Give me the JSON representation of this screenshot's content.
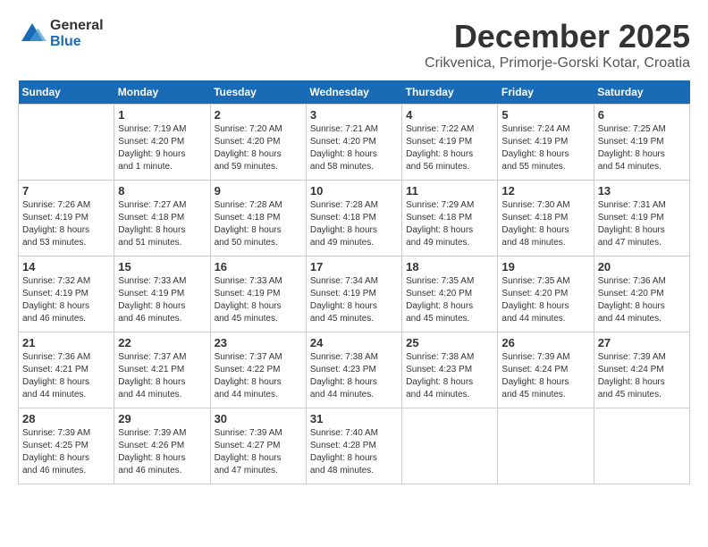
{
  "logo": {
    "text_general": "General",
    "text_blue": "Blue"
  },
  "header": {
    "month_year": "December 2025",
    "location": "Crikvenica, Primorje-Gorski Kotar, Croatia"
  },
  "weekdays": [
    "Sunday",
    "Monday",
    "Tuesday",
    "Wednesday",
    "Thursday",
    "Friday",
    "Saturday"
  ],
  "weeks": [
    [
      {
        "day": "",
        "info": ""
      },
      {
        "day": "1",
        "info": "Sunrise: 7:19 AM\nSunset: 4:20 PM\nDaylight: 9 hours\nand 1 minute."
      },
      {
        "day": "2",
        "info": "Sunrise: 7:20 AM\nSunset: 4:20 PM\nDaylight: 8 hours\nand 59 minutes."
      },
      {
        "day": "3",
        "info": "Sunrise: 7:21 AM\nSunset: 4:20 PM\nDaylight: 8 hours\nand 58 minutes."
      },
      {
        "day": "4",
        "info": "Sunrise: 7:22 AM\nSunset: 4:19 PM\nDaylight: 8 hours\nand 56 minutes."
      },
      {
        "day": "5",
        "info": "Sunrise: 7:24 AM\nSunset: 4:19 PM\nDaylight: 8 hours\nand 55 minutes."
      },
      {
        "day": "6",
        "info": "Sunrise: 7:25 AM\nSunset: 4:19 PM\nDaylight: 8 hours\nand 54 minutes."
      }
    ],
    [
      {
        "day": "7",
        "info": "Sunrise: 7:26 AM\nSunset: 4:19 PM\nDaylight: 8 hours\nand 53 minutes."
      },
      {
        "day": "8",
        "info": "Sunrise: 7:27 AM\nSunset: 4:18 PM\nDaylight: 8 hours\nand 51 minutes."
      },
      {
        "day": "9",
        "info": "Sunrise: 7:28 AM\nSunset: 4:18 PM\nDaylight: 8 hours\nand 50 minutes."
      },
      {
        "day": "10",
        "info": "Sunrise: 7:28 AM\nSunset: 4:18 PM\nDaylight: 8 hours\nand 49 minutes."
      },
      {
        "day": "11",
        "info": "Sunrise: 7:29 AM\nSunset: 4:18 PM\nDaylight: 8 hours\nand 49 minutes."
      },
      {
        "day": "12",
        "info": "Sunrise: 7:30 AM\nSunset: 4:18 PM\nDaylight: 8 hours\nand 48 minutes."
      },
      {
        "day": "13",
        "info": "Sunrise: 7:31 AM\nSunset: 4:19 PM\nDaylight: 8 hours\nand 47 minutes."
      }
    ],
    [
      {
        "day": "14",
        "info": "Sunrise: 7:32 AM\nSunset: 4:19 PM\nDaylight: 8 hours\nand 46 minutes."
      },
      {
        "day": "15",
        "info": "Sunrise: 7:33 AM\nSunset: 4:19 PM\nDaylight: 8 hours\nand 46 minutes."
      },
      {
        "day": "16",
        "info": "Sunrise: 7:33 AM\nSunset: 4:19 PM\nDaylight: 8 hours\nand 45 minutes."
      },
      {
        "day": "17",
        "info": "Sunrise: 7:34 AM\nSunset: 4:19 PM\nDaylight: 8 hours\nand 45 minutes."
      },
      {
        "day": "18",
        "info": "Sunrise: 7:35 AM\nSunset: 4:20 PM\nDaylight: 8 hours\nand 45 minutes."
      },
      {
        "day": "19",
        "info": "Sunrise: 7:35 AM\nSunset: 4:20 PM\nDaylight: 8 hours\nand 44 minutes."
      },
      {
        "day": "20",
        "info": "Sunrise: 7:36 AM\nSunset: 4:20 PM\nDaylight: 8 hours\nand 44 minutes."
      }
    ],
    [
      {
        "day": "21",
        "info": "Sunrise: 7:36 AM\nSunset: 4:21 PM\nDaylight: 8 hours\nand 44 minutes."
      },
      {
        "day": "22",
        "info": "Sunrise: 7:37 AM\nSunset: 4:21 PM\nDaylight: 8 hours\nand 44 minutes."
      },
      {
        "day": "23",
        "info": "Sunrise: 7:37 AM\nSunset: 4:22 PM\nDaylight: 8 hours\nand 44 minutes."
      },
      {
        "day": "24",
        "info": "Sunrise: 7:38 AM\nSunset: 4:23 PM\nDaylight: 8 hours\nand 44 minutes."
      },
      {
        "day": "25",
        "info": "Sunrise: 7:38 AM\nSunset: 4:23 PM\nDaylight: 8 hours\nand 44 minutes."
      },
      {
        "day": "26",
        "info": "Sunrise: 7:39 AM\nSunset: 4:24 PM\nDaylight: 8 hours\nand 45 minutes."
      },
      {
        "day": "27",
        "info": "Sunrise: 7:39 AM\nSunset: 4:24 PM\nDaylight: 8 hours\nand 45 minutes."
      }
    ],
    [
      {
        "day": "28",
        "info": "Sunrise: 7:39 AM\nSunset: 4:25 PM\nDaylight: 8 hours\nand 46 minutes."
      },
      {
        "day": "29",
        "info": "Sunrise: 7:39 AM\nSunset: 4:26 PM\nDaylight: 8 hours\nand 46 minutes."
      },
      {
        "day": "30",
        "info": "Sunrise: 7:39 AM\nSunset: 4:27 PM\nDaylight: 8 hours\nand 47 minutes."
      },
      {
        "day": "31",
        "info": "Sunrise: 7:40 AM\nSunset: 4:28 PM\nDaylight: 8 hours\nand 48 minutes."
      },
      {
        "day": "",
        "info": ""
      },
      {
        "day": "",
        "info": ""
      },
      {
        "day": "",
        "info": ""
      }
    ]
  ]
}
